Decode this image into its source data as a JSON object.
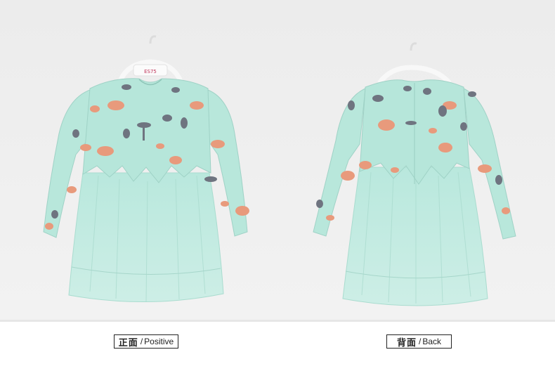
{
  "captions": {
    "front_cn": "正面",
    "front_sep": "/",
    "front_en": "Positive",
    "back_cn": "背面",
    "back_sep": "/",
    "back_en": "Back"
  },
  "hanger_tag": "ES75",
  "colors": {
    "photo_background": "#efefef",
    "dress_mint": "#b6e6da",
    "tulle": "#bfe9df",
    "hanger": "#fafafa",
    "print_orange": "#e89a7c",
    "print_gray": "#6f7480"
  }
}
